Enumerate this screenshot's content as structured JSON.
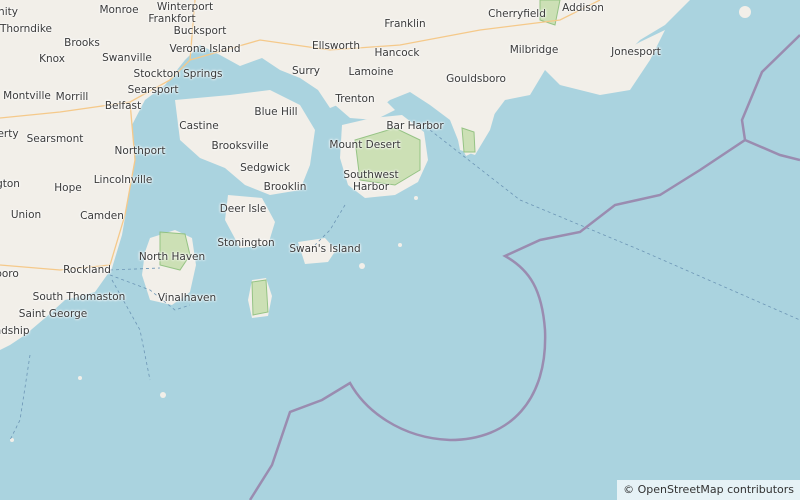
{
  "map": {
    "colors": {
      "water": "#aad3df",
      "land": "#f2efe9",
      "park": "#c8dfb0",
      "boundary": "#9a8cb0",
      "road": "#f5c98a",
      "ferry": "#6c95b5"
    },
    "places": [
      {
        "name": "Winterport",
        "partial": "Winterport"
      },
      {
        "name": "Unity",
        "partial": "nity"
      },
      {
        "name": "Monroe"
      },
      {
        "name": "Frankfort"
      },
      {
        "name": "Thorndike"
      },
      {
        "name": "Brooks"
      },
      {
        "name": "Bucksport"
      },
      {
        "name": "Verona Island"
      },
      {
        "name": "Knox"
      },
      {
        "name": "Swanville"
      },
      {
        "name": "Stockton Springs"
      },
      {
        "name": "Searsport"
      },
      {
        "name": "Montville"
      },
      {
        "name": "Morrill"
      },
      {
        "name": "Belfast"
      },
      {
        "name": "Liberty",
        "partial": "erty"
      },
      {
        "name": "Searsmont"
      },
      {
        "name": "Castine"
      },
      {
        "name": "Northport"
      },
      {
        "name": "Brooksville"
      },
      {
        "name": "Blue Hill"
      },
      {
        "name": "Sedgwick"
      },
      {
        "name": "Washington",
        "partial": "gton"
      },
      {
        "name": "Hope"
      },
      {
        "name": "Lincolnville"
      },
      {
        "name": "Brooklin"
      },
      {
        "name": "Union"
      },
      {
        "name": "Camden"
      },
      {
        "name": "Deer Isle"
      },
      {
        "name": "Stonington"
      },
      {
        "name": "North Haven"
      },
      {
        "name": "Waldoboro",
        "partial": "boro"
      },
      {
        "name": "Rockland"
      },
      {
        "name": "South Thomaston"
      },
      {
        "name": "Vinalhaven"
      },
      {
        "name": "Saint George"
      },
      {
        "name": "Friendship",
        "partial": "ndship"
      },
      {
        "name": "Swan's Island"
      },
      {
        "name": "Ellsworth"
      },
      {
        "name": "Franklin"
      },
      {
        "name": "Hancock"
      },
      {
        "name": "Surry"
      },
      {
        "name": "Lamoine"
      },
      {
        "name": "Trenton"
      },
      {
        "name": "Bar Harbor"
      },
      {
        "name": "Mount Desert"
      },
      {
        "name": "Southwest Harbor"
      },
      {
        "name": "Gouldsboro"
      },
      {
        "name": "Cherryfield"
      },
      {
        "name": "Addison"
      },
      {
        "name": "Milbridge"
      },
      {
        "name": "Jonesport"
      }
    ]
  },
  "attribution": "© OpenStreetMap contributors"
}
